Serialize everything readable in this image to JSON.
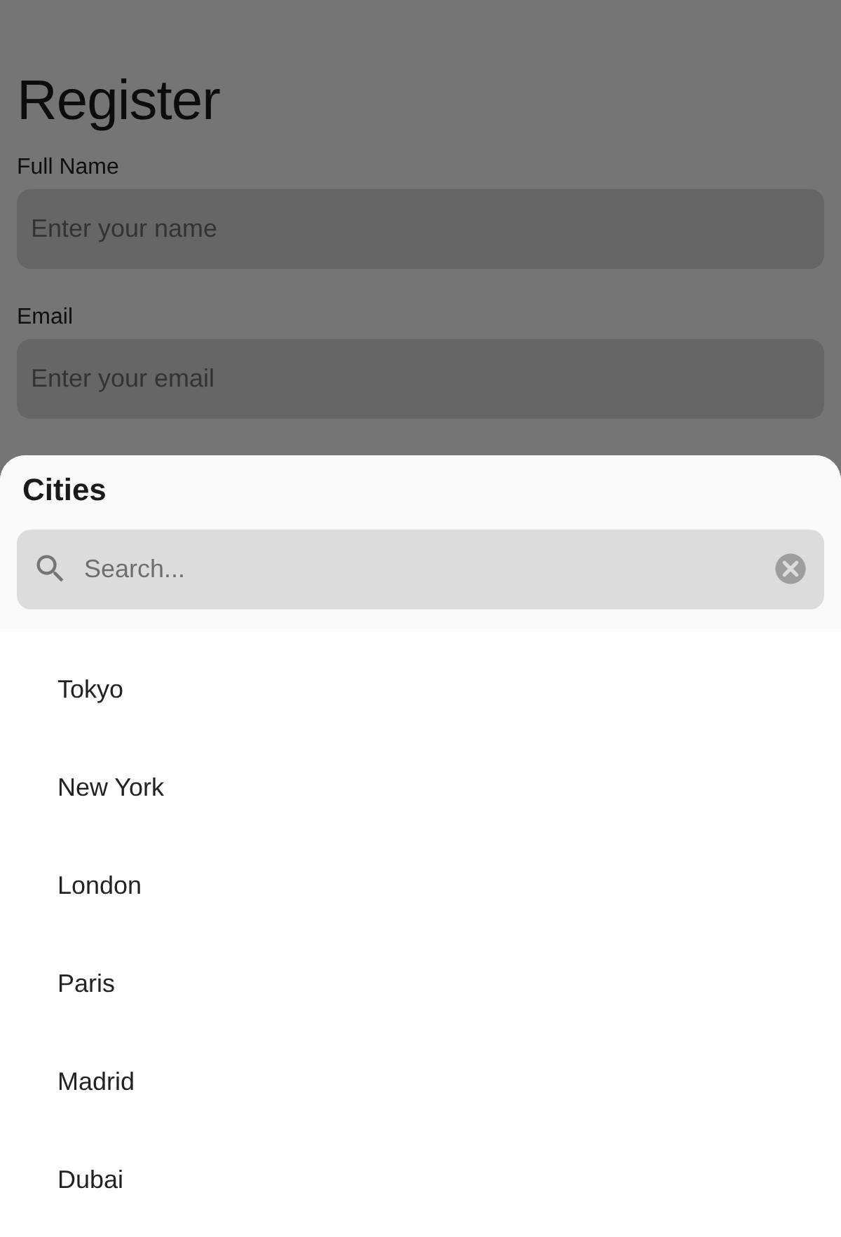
{
  "form": {
    "title": "Register",
    "fields": [
      {
        "label": "Full Name",
        "placeholder": "Enter your name"
      },
      {
        "label": "Email",
        "placeholder": "Enter your email"
      }
    ]
  },
  "sheet": {
    "title": "Cities",
    "search": {
      "placeholder": "Search..."
    },
    "items": [
      "Tokyo",
      "New York",
      "London",
      "Paris",
      "Madrid",
      "Dubai"
    ]
  }
}
